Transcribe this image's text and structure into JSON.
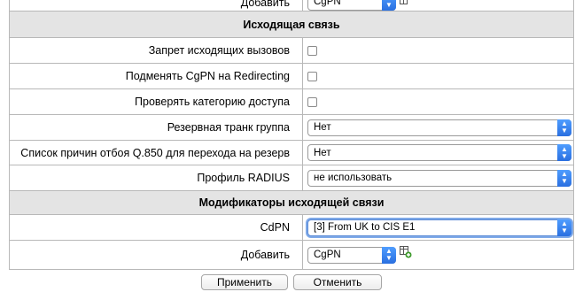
{
  "top_row": {
    "label": "Добавить",
    "select_value": "CgPN"
  },
  "outgoing": {
    "title": "Исходящая связь",
    "rows": [
      {
        "label": "Запрет исходящих вызовов"
      },
      {
        "label": "Подменять CgPN на Redirecting"
      },
      {
        "label": "Проверять категорию доступа"
      }
    ],
    "reserve_trunk": {
      "label": "Резервная транк группа",
      "value": "Нет"
    },
    "q850": {
      "label": "Список причин отбоя Q.850 для перехода на резерв",
      "value": "Нет"
    },
    "radius": {
      "label": "Профиль RADIUS",
      "value": "не использовать"
    }
  },
  "modifiers": {
    "title": "Модификаторы исходящей связи",
    "cdpn": {
      "label": "CdPN",
      "value": "[3] From UK to CIS E1"
    },
    "add": {
      "label": "Добавить",
      "value": "CgPN"
    }
  },
  "buttons": {
    "apply": "Применить",
    "cancel": "Отменить"
  },
  "colors": {
    "section_bg": "#e4e4e4",
    "select_arrow": "#2a6fe0",
    "focus_ring": "#7fa9e8"
  }
}
